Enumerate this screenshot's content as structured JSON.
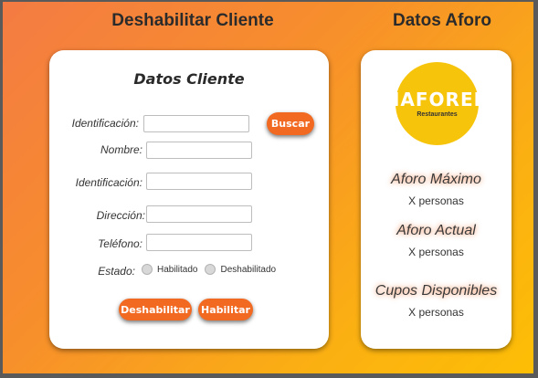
{
  "header": {
    "left_title": "Deshabilitar Cliente",
    "right_title": "Datos Aforo"
  },
  "client_form": {
    "title": "Datos Cliente",
    "search_id_label": "Identificación:",
    "search_id_value": "",
    "search_button": "Buscar",
    "name_label": "Nombre:",
    "name_value": "",
    "id_label": "Identificación:",
    "id_value": "",
    "address_label": "Dirección:",
    "address_value": "",
    "phone_label": "Teléfono:",
    "phone_value": "",
    "state_label": "Estado:",
    "state_options": [
      "Habilitado",
      "Deshabilitado"
    ],
    "disable_button": "Deshabilitar",
    "enable_button": "Habilitar"
  },
  "aforo": {
    "logo_text": "IAFOREI",
    "logo_subtext": "Restaurantes",
    "max_label": "Aforo Máximo",
    "max_value": "X personas",
    "current_label": "Aforo Actual",
    "current_value": "X personas",
    "available_label": "Cupos Disponibles",
    "available_value": "X personas"
  },
  "colors": {
    "accent": "#f26a22",
    "gradient_start": "#f47b43",
    "gradient_end": "#fdbe05",
    "logo_bg": "#f7c40c"
  }
}
